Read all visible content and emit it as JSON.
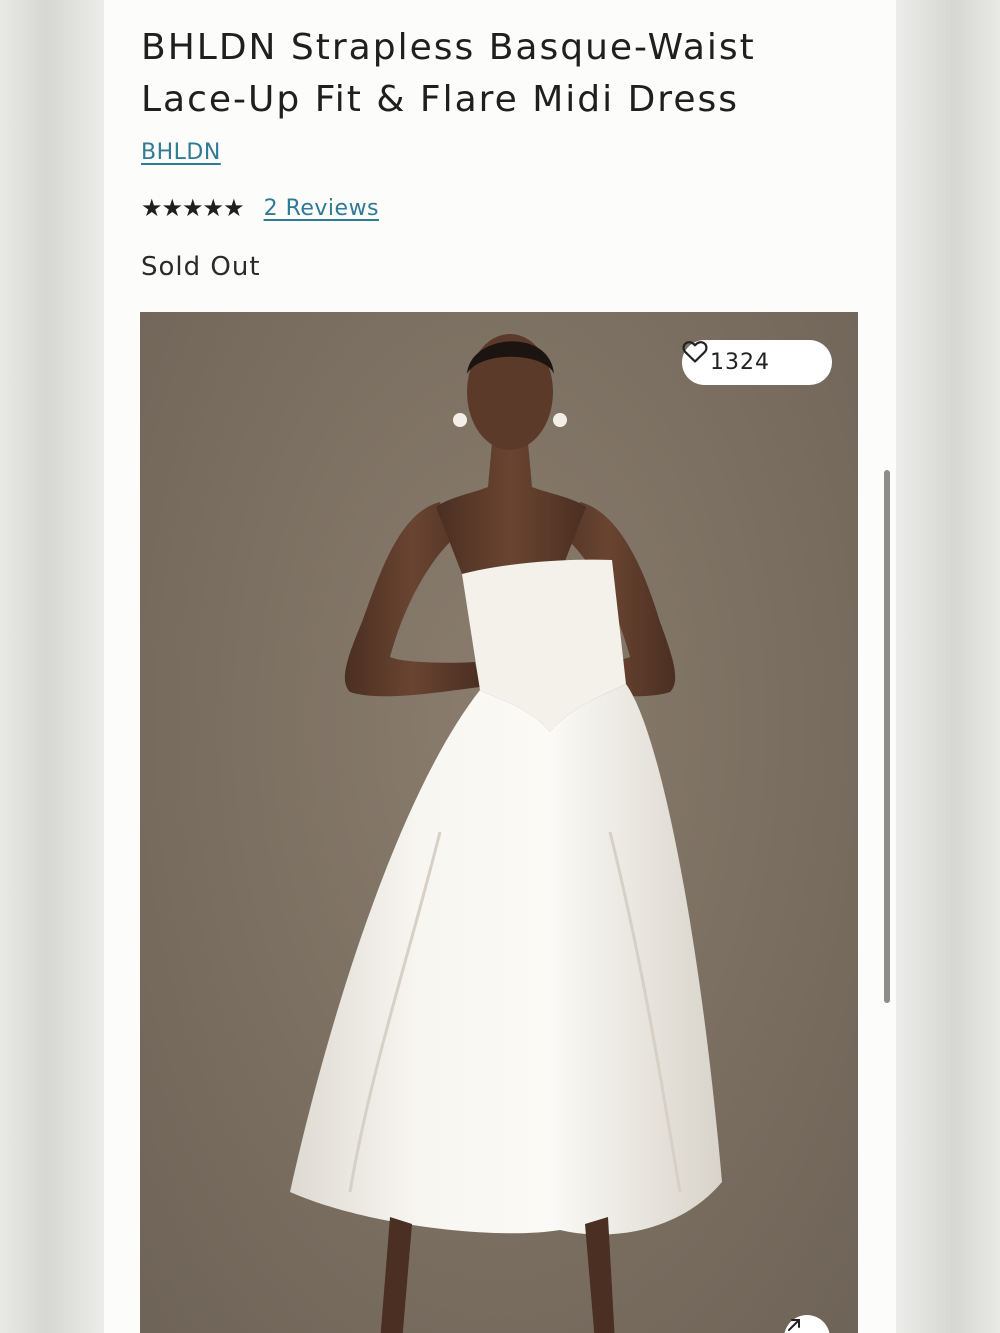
{
  "product": {
    "title": "BHLDN Strapless Basque-Waist Lace-Up Fit & Flare Midi Dress",
    "brand": "BHLDN",
    "stars": "★★★★★",
    "rating_value": 5,
    "rating_max": 5,
    "reviews_link": "2 Reviews",
    "status": "Sold Out"
  },
  "gallery": {
    "favorite_count": "1324",
    "favorite_icon": "heart-icon",
    "expand_icon": "expand-arrow-icon"
  },
  "colors": {
    "link": "#2f7a95",
    "text": "#1f1f1f",
    "image_background": "#7c7062"
  }
}
